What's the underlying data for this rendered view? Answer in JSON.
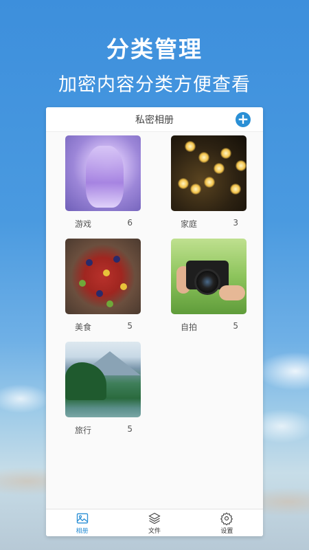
{
  "hero": {
    "title": "分类管理",
    "subtitle": "加密内容分类方便查看"
  },
  "header": {
    "title": "私密相册",
    "add_label": "+"
  },
  "albums": [
    {
      "name": "游戏",
      "count": "6",
      "thumb": "anime-girl-image"
    },
    {
      "name": "家庭",
      "count": "3",
      "thumb": "string-lights-image"
    },
    {
      "name": "美食",
      "count": "5",
      "thumb": "fruit-tart-image"
    },
    {
      "name": "自拍",
      "count": "5",
      "thumb": "camera-hands-image"
    },
    {
      "name": "旅行",
      "count": "5",
      "thumb": "mountain-lake-image"
    }
  ],
  "tabs": [
    {
      "label": "相册",
      "icon": "image-icon",
      "active": true
    },
    {
      "label": "文件",
      "icon": "layers-icon",
      "active": false
    },
    {
      "label": "设置",
      "icon": "gear-icon",
      "active": false
    }
  ],
  "colors": {
    "accent": "#2a8fd5",
    "background": "#3d8fdc"
  }
}
